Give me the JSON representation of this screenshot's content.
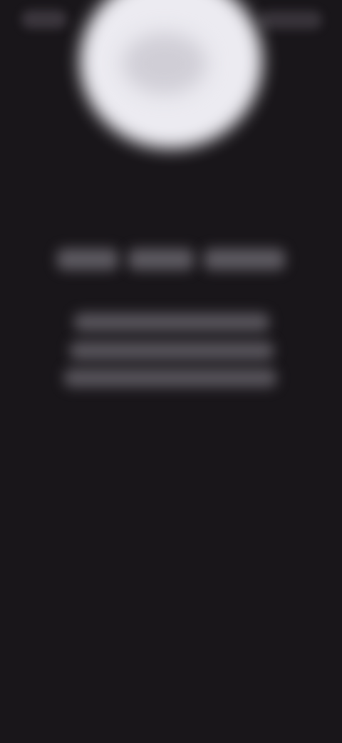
{
  "status_bar": {
    "time": "",
    "icons": [
      "signal-icon",
      "wifi-icon",
      "battery-icon"
    ]
  },
  "hero": {
    "icon": "illustration-icon"
  },
  "heading": {
    "text": ""
  },
  "body": {
    "lines": [
      "",
      "",
      ""
    ]
  },
  "colors": {
    "background": "#19161a",
    "illustration": "#ecebf1",
    "text_blur": "#8c8892"
  }
}
